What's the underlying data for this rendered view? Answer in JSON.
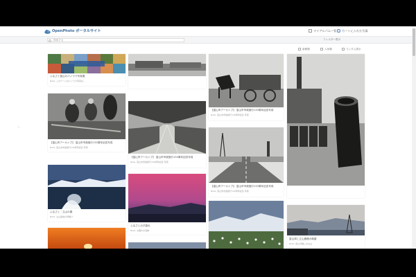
{
  "header": {
    "site_title": "OpenPhoto ポータルサイト",
    "links": [
      "マイアルバム一覧",
      "カートに入れた写真"
    ]
  },
  "search": {
    "placeholder": "検索する",
    "filter_label": "フィルター表示"
  },
  "sort_buttons": [
    "新着順",
    "人気順",
    "ランダム表示"
  ],
  "cards": [
    {
      "title": "ふるさと富山のパノラマ写真展",
      "sub": "Note: このページのパノラマ写真は…"
    },
    {
      "title": "",
      "sub": ""
    },
    {
      "title": "",
      "sub": ""
    },
    {
      "title": "",
      "sub": ""
    },
    {
      "title": "【富山市アーカイブ】 富山市市政施行130周年記念写真",
      "sub": "Note: 富山市市政施行130周年記念 写真"
    },
    {
      "title": "【富山市アーカイブ】 富山市市政施行130周年記念写真",
      "sub": "Note: 富山市市政施行130周年記念 写真"
    },
    {
      "title": "【富山市アーカイブ】 富山市市政施行130周年記念写真",
      "sub": "Note: 富山市市政施行130周年記念 写真"
    },
    {
      "title": "【富山市アーカイブ】 富山市市政施行130周年記念写真",
      "sub": "Note: 富山市市政施行130周年記念 写真"
    },
    {
      "title": "ふるさと・立山の春",
      "sub": "Note: 立山連峰の雪解け"
    },
    {
      "title": "ふるさとの夕暮れ",
      "sub": "Note: 夕暮れの海岸"
    },
    {
      "title": "",
      "sub": ""
    },
    {
      "title": "富山湾と立山連峰の眺望",
      "sub": "Note: 富山湾越しの立山"
    },
    {
      "title": "",
      "sub": ""
    },
    {
      "title": "",
      "sub": ""
    },
    {
      "title": "",
      "sub": ""
    }
  ],
  "colors": {
    "title_blue": "#3a6a99",
    "background": "#ffffff"
  },
  "icons": [
    "logo-cloud-icon",
    "album-icon",
    "cart-icon",
    "search-icon",
    "sort-icon",
    "scrollbar"
  ]
}
